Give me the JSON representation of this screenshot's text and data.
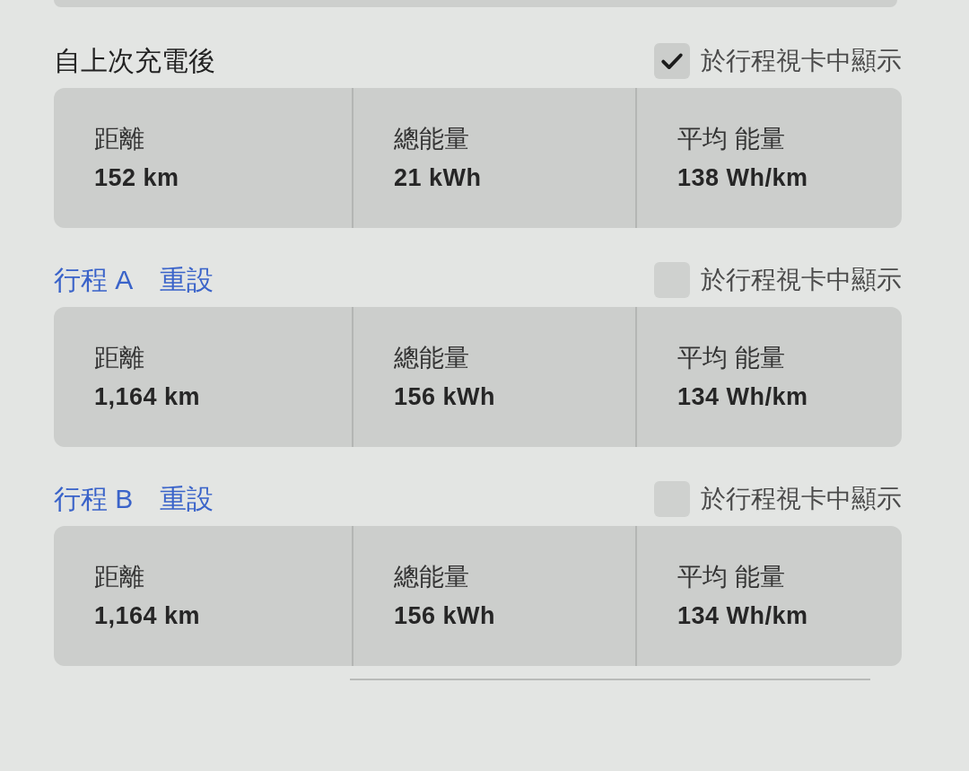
{
  "sections": [
    {
      "kind": "since_charge",
      "title": "自上次充電後",
      "show_in_trip_card": {
        "label": "於行程視卡中顯示",
        "checked": true
      },
      "stats": [
        {
          "label": "距離",
          "value": "152 km"
        },
        {
          "label": "總能量",
          "value": "21 kWh"
        },
        {
          "label": "平均 能量",
          "value": "138 Wh/km"
        }
      ]
    },
    {
      "kind": "trip",
      "title": "行程 A",
      "reset": "重設",
      "show_in_trip_card": {
        "label": "於行程視卡中顯示",
        "checked": false
      },
      "stats": [
        {
          "label": "距離",
          "value": "1,164 km"
        },
        {
          "label": "總能量",
          "value": "156 kWh"
        },
        {
          "label": "平均 能量",
          "value": "134 Wh/km"
        }
      ]
    },
    {
      "kind": "trip",
      "title": "行程 B",
      "reset": "重設",
      "show_in_trip_card": {
        "label": "於行程視卡中顯示",
        "checked": false
      },
      "stats": [
        {
          "label": "距離",
          "value": "1,164 km"
        },
        {
          "label": "總能量",
          "value": "156 kWh"
        },
        {
          "label": "平均 能量",
          "value": "134 Wh/km"
        }
      ]
    }
  ]
}
